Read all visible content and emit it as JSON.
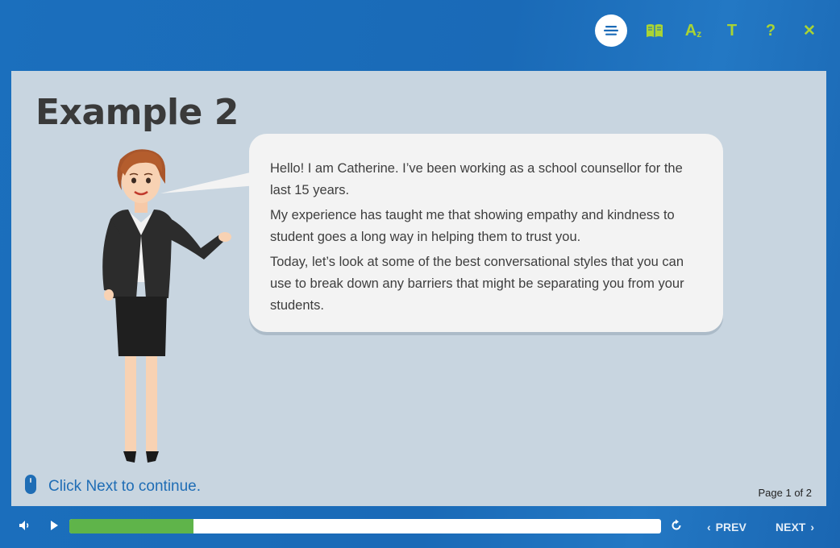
{
  "toolbar": {
    "menu_icon": "menu-lines-icon",
    "glossary_icon": "book-icon",
    "font_size_label": "A",
    "font_size_sub": "z",
    "text_label": "T",
    "help_label": "?",
    "close_label": "✕"
  },
  "slide": {
    "title": "Example 2",
    "speech": [
      "Hello! I am Catherine. I’ve been working as a school counsellor for the last 15 years.",
      "My experience has taught me that showing empathy and kindness to student goes a long way in helping them to trust you.",
      "Today, let’s look at some of the best conversational styles that you can use to break down any barriers that might be separating you from your students."
    ],
    "hint": "Click Next to continue.",
    "page_indicator": "Page 1 of 2"
  },
  "player": {
    "progress_fraction": 0.21,
    "prev_label": "PREV",
    "next_label": "NEXT",
    "colors": {
      "accent": "#a9d434",
      "progress": "#5fb44a",
      "frame": "#1a6ab7",
      "stage": "#c8d5e0"
    }
  }
}
